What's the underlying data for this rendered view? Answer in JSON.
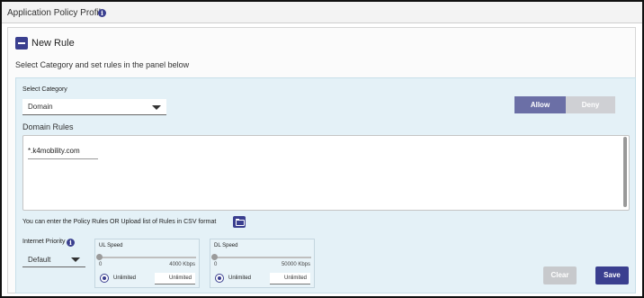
{
  "header": {
    "title": "Application Policy Profile"
  },
  "new_rule": {
    "label": "New Rule",
    "instructions": "Select Category and set rules in the panel below"
  },
  "category": {
    "label": "Select Category",
    "selected": "Domain"
  },
  "action_toggle": {
    "allow_label": "Allow",
    "deny_label": "Deny",
    "selected": "Allow"
  },
  "domain_rules": {
    "label": "Domain Rules",
    "entries": [
      "*.k4mobility.com"
    ]
  },
  "upload": {
    "text": "You can enter the Policy Rules OR Upload list of Rules in CSV format"
  },
  "priority": {
    "label": "Internet Priority",
    "selected": "Default"
  },
  "ul_speed": {
    "title": "UL Speed",
    "min": "0",
    "max": "4000 Kbps",
    "slider_level": 0,
    "radio_label": "Unlimited",
    "input_value": "Unlimited"
  },
  "dl_speed": {
    "title": "DL Speed",
    "min": "0",
    "max": "50000 Kbps",
    "slider_level": 0,
    "radio_label": "Unlimited",
    "input_value": "Unlimited"
  },
  "footer": {
    "clear_label": "Clear",
    "save_label": "Save"
  },
  "colors": {
    "primary": "#3a3f8f",
    "allow_active": "#6b6fa6",
    "inactive": "#cfd0d4",
    "panel_bg": "#e4f1f7"
  },
  "icons": {
    "info": "info-icon",
    "collapse": "minus-icon",
    "upload": "folder-icon",
    "dropdown": "caret-down-icon"
  }
}
